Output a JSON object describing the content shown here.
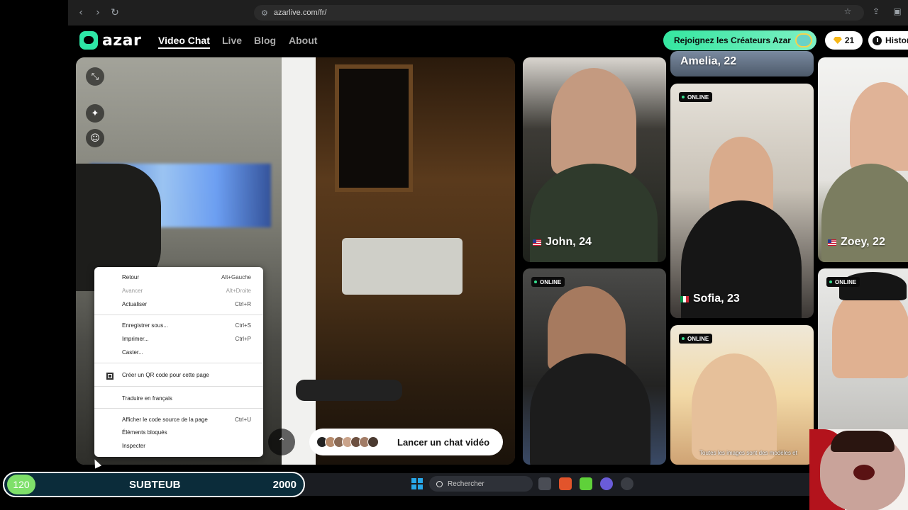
{
  "browser": {
    "url": "azarlive.com/fr/"
  },
  "header": {
    "brand": "azar",
    "nav": [
      "Video Chat",
      "Live",
      "Blog",
      "About"
    ],
    "cta_label": "Rejoignez les Créateurs Azar",
    "gems": "21",
    "history_label": "Histor"
  },
  "video_panel": {
    "launch_label": "Lancer un chat vidéo"
  },
  "profiles": [
    {
      "name": "Amelia, 22",
      "online": false,
      "flag": ""
    },
    {
      "name": "John, 24",
      "online": false,
      "flag": "us"
    },
    {
      "name": "Sofia, 23",
      "online": true,
      "flag": "it"
    },
    {
      "name": "Zoey, 22",
      "online": false,
      "flag": "us"
    },
    {
      "name": "",
      "online": true,
      "flag": ""
    },
    {
      "name": "",
      "online": true,
      "flag": ""
    },
    {
      "name": "",
      "online": true,
      "flag": ""
    }
  ],
  "badge_label": "ONLINE",
  "disclaimer": "Toutes les images sont des modèles et",
  "context_menu": {
    "items": [
      {
        "label": "Retour",
        "shortcut": "Alt+Gauche"
      },
      {
        "label": "Avancer",
        "shortcut": "Alt+Droite",
        "disabled": true
      },
      {
        "label": "Actualiser",
        "shortcut": "Ctrl+R"
      },
      {
        "label": "Enregistrer sous...",
        "shortcut": "Ctrl+S"
      },
      {
        "label": "Imprimer...",
        "shortcut": "Ctrl+P"
      },
      {
        "label": "Caster...",
        "shortcut": ""
      },
      {
        "label": "Créer un QR code pour cette page",
        "shortcut": ""
      },
      {
        "label": "Traduire en français",
        "shortcut": ""
      },
      {
        "label": "Afficher le code source de la page",
        "shortcut": "Ctrl+U"
      },
      {
        "label": "Éléments bloqués",
        "shortcut": ""
      },
      {
        "label": "Inspecter",
        "shortcut": ""
      }
    ]
  },
  "taskbar": {
    "search_placeholder": "Rechercher"
  },
  "overlay": {
    "sub_count": "120",
    "sub_title": "SUBTEUB",
    "sub_goal": "2000"
  },
  "colors": {
    "accent": "#2ee6a6",
    "online_dot": "#36e08f"
  }
}
